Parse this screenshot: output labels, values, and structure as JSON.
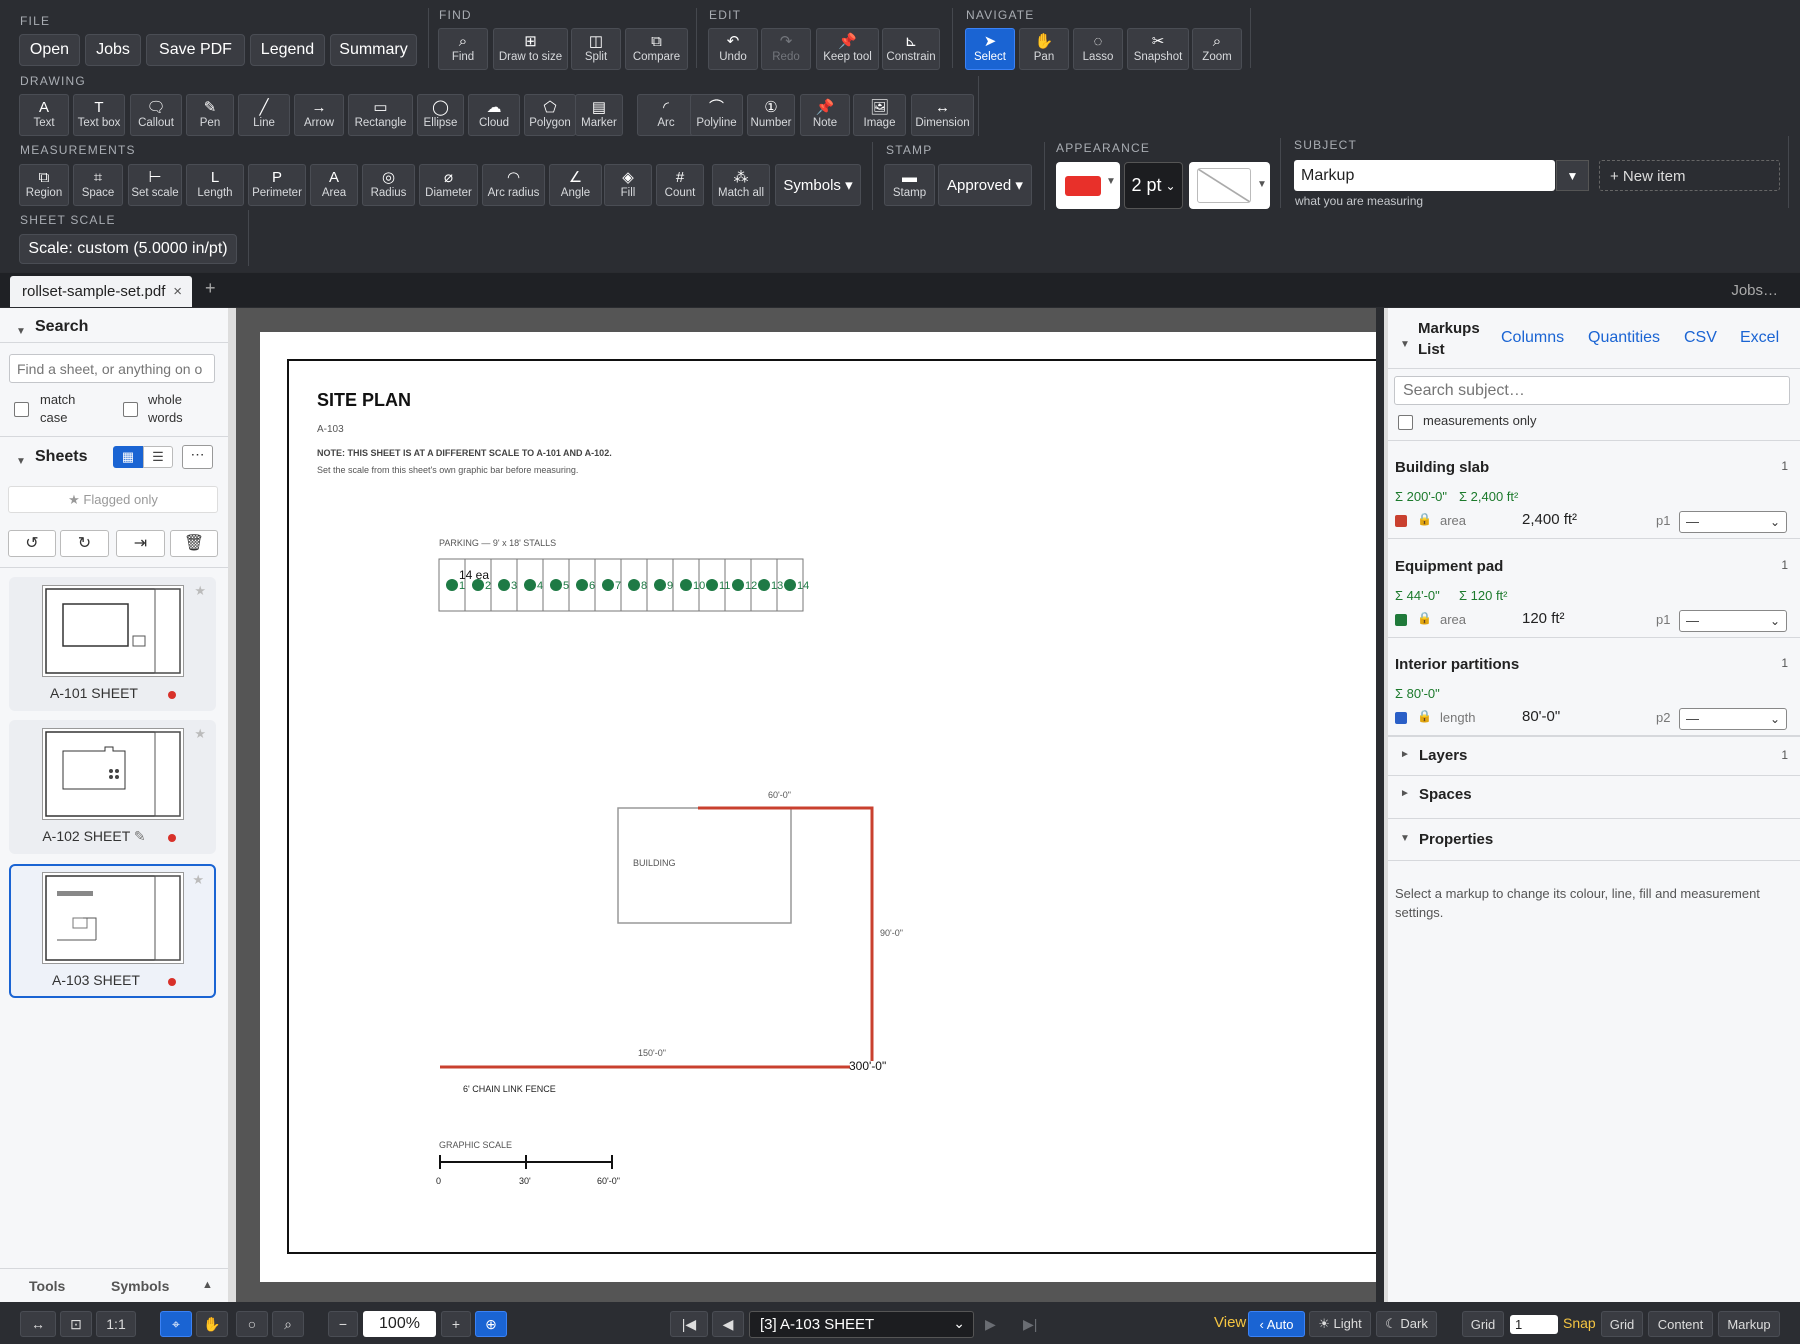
{
  "toolbar": {
    "groups": {
      "file": "FILE",
      "find": "FIND",
      "edit": "EDIT",
      "navigate": "NAVIGATE",
      "drawing": "DRAWING",
      "measurements": "MEASUREMENTS",
      "stamp": "STAMP",
      "appearance": "APPEARANCE",
      "subject": "SUBJECT",
      "sheet_scale": "SHEET SCALE"
    },
    "file_buttons": [
      "Open",
      "Jobs",
      "Save PDF",
      "Legend",
      "Summary"
    ],
    "find_tools": [
      {
        "icon": "⌕",
        "label": "Find"
      },
      {
        "icon": "⊞",
        "label": "Draw to size"
      },
      {
        "icon": "◫",
        "label": "Split"
      },
      {
        "icon": "⧉",
        "label": "Compare"
      }
    ],
    "edit_tools": [
      {
        "icon": "↶",
        "label": "Undo"
      },
      {
        "icon": "↷",
        "label": "Redo"
      },
      {
        "icon": "📌",
        "label": "Keep tool"
      },
      {
        "icon": "⊾",
        "label": "Constrain"
      }
    ],
    "navigate_tools": [
      {
        "icon": "➤",
        "label": "Select"
      },
      {
        "icon": "✋",
        "label": "Pan"
      },
      {
        "icon": "◌",
        "label": "Lasso"
      },
      {
        "icon": "✂",
        "label": "Snapshot"
      },
      {
        "icon": "⌕",
        "label": "Zoom"
      }
    ],
    "drawing_tools": [
      {
        "icon": "A",
        "label": "Text"
      },
      {
        "icon": "T",
        "label": "Text box"
      },
      {
        "icon": "🗨",
        "label": "Callout"
      },
      {
        "icon": "✎",
        "label": "Pen"
      },
      {
        "icon": "╱",
        "label": "Line"
      },
      {
        "icon": "→",
        "label": "Arrow"
      },
      {
        "icon": "▭",
        "label": "Rectangle"
      },
      {
        "icon": "◯",
        "label": "Ellipse"
      },
      {
        "icon": "☁",
        "label": "Cloud"
      },
      {
        "icon": "⬠",
        "label": "Polygon"
      },
      {
        "icon": "▤",
        "label": "Marker"
      },
      {
        "icon": "◜",
        "label": "Arc"
      },
      {
        "icon": "⌒",
        "label": "Polyline"
      },
      {
        "icon": "①",
        "label": "Number"
      },
      {
        "icon": "📌",
        "label": "Note"
      },
      {
        "icon": "🖼",
        "label": "Image"
      },
      {
        "icon": "↔",
        "label": "Dimension"
      }
    ],
    "measure_tools": [
      {
        "icon": "⧉",
        "label": "Region"
      },
      {
        "icon": "⌗",
        "label": "Space"
      },
      {
        "icon": "⊢",
        "label": "Set scale"
      },
      {
        "icon": "L",
        "label": "Length"
      },
      {
        "icon": "P",
        "label": "Perimeter"
      },
      {
        "icon": "A",
        "label": "Area"
      },
      {
        "icon": "◎",
        "label": "Radius"
      },
      {
        "icon": "⌀",
        "label": "Diameter"
      },
      {
        "icon": "◠",
        "label": "Arc radius"
      },
      {
        "icon": "∠",
        "label": "Angle"
      },
      {
        "icon": "◈",
        "label": "Fill"
      },
      {
        "icon": "#",
        "label": "Count"
      },
      {
        "icon": "⁂",
        "label": "Match all"
      }
    ],
    "symbols_label": "Symbols ▾",
    "stamp_tool": {
      "icon": "▬",
      "label": "Stamp"
    },
    "stamp_value": "Approved ▾",
    "appearance": {
      "color": "#e8302a",
      "line_width": "2 pt"
    },
    "subject": {
      "value": "Markup",
      "hint": "what you are measuring",
      "new_item": "+ New item"
    },
    "scale_label": "Scale: custom (5.0000 in/pt)"
  },
  "tabs": {
    "doc": "rollset-sample-set.pdf",
    "add": "+",
    "jobs": "Jobs…"
  },
  "left": {
    "search_title": "Search",
    "search_placeholder": "Find a sheet, or anything on o",
    "match_case": "match case",
    "whole_words": "whole words",
    "sheets_title": "Sheets",
    "flagged": "★ Flagged only",
    "sheets": [
      {
        "name": "A-101 SHEET"
      },
      {
        "name": "A-102 SHEET"
      },
      {
        "name": "A-103 SHEET"
      }
    ],
    "footer_tools": "Tools",
    "footer_symbols": "Symbols"
  },
  "plan": {
    "title": "SITE PLAN",
    "sheet_no": "A-103",
    "note1": "NOTE: THIS SHEET IS AT A DIFFERENT SCALE TO A-101 AND A-102.",
    "note2": "Set the scale from this sheet's own graphic bar before measuring.",
    "parking": "PARKING — 9' x 18' STALLS",
    "count_label": "14 ea",
    "building": "BUILDING",
    "dim_top": "60'-0\"",
    "dim_right": "90'-0\"",
    "dim_bottom": "150'-0\"",
    "total": "300'-0\"",
    "fence": "6' CHAIN LINK FENCE",
    "graphic_scale": "GRAPHIC SCALE",
    "scale_0": "0",
    "scale_30": "30'",
    "scale_60": "60'-0\""
  },
  "right": {
    "title": "Markups List",
    "links": [
      "Columns",
      "Quantities",
      "CSV",
      "Excel"
    ],
    "search_placeholder": "Search subject…",
    "measurements_only": "measurements only",
    "groups": [
      {
        "name": "Building slab",
        "count": "1",
        "sums": [
          "Σ 200'-0\"",
          "Σ 2,400 ft²"
        ],
        "color": "#c9402f",
        "type": "area",
        "value": "2,400 ft²",
        "page": "p1",
        "sel": "—"
      },
      {
        "name": "Equipment pad",
        "count": "1",
        "sums": [
          "Σ 44'-0\"",
          "Σ 120 ft²"
        ],
        "color": "#1f7a3a",
        "type": "area",
        "value": "120 ft²",
        "page": "p1",
        "sel": "—"
      },
      {
        "name": "Interior partitions",
        "count": "1",
        "sums": [
          "Σ 80'-0\""
        ],
        "color": "#2a5fc7",
        "type": "length",
        "value": "80'-0\"",
        "page": "p2",
        "sel": "—"
      }
    ],
    "layers": "Layers",
    "layers_count": "1",
    "spaces": "Spaces",
    "properties": "Properties",
    "properties_hint": "Select a markup to change its colour, line, fill and measurement settings."
  },
  "bottom": {
    "zoom": "100%",
    "page_select": "[3] A-103 SHEET",
    "view": "View",
    "auto": "‹ Auto",
    "light": "☀ Light",
    "dark": "☾ Dark",
    "grid": "Grid",
    "grid_value": "1",
    "snap": "Snap",
    "snap_grid": "Grid",
    "content": "Content",
    "markup": "Markup"
  }
}
